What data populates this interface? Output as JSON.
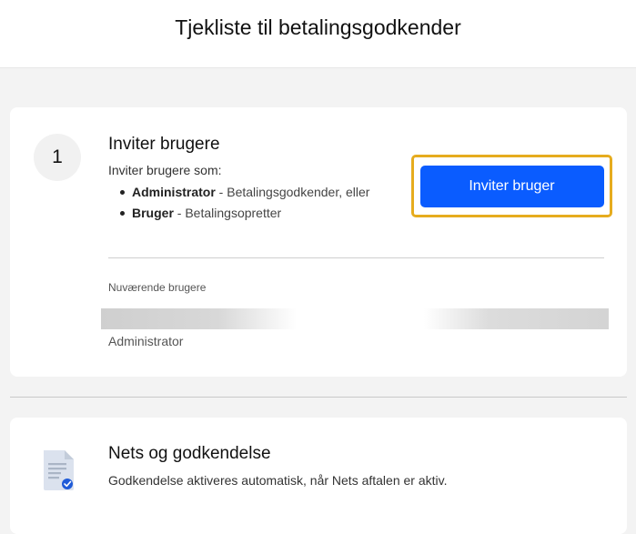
{
  "header": {
    "title": "Tjekliste til betalingsgodkender"
  },
  "step1": {
    "number": "1",
    "title": "Inviter brugere",
    "subtitle": "Inviter brugere som:",
    "roles": [
      {
        "name": "Administrator",
        "description": " - Betalingsgodkender, eller"
      },
      {
        "name": "Bruger",
        "description": " - Betalingsopretter"
      }
    ],
    "invite_button_label": "Inviter bruger",
    "current_users_label": "Nuværende brugere",
    "current_user_role": "Administrator",
    "accent_color": "#0a5cff",
    "highlight_color": "#e6ac1e"
  },
  "step2": {
    "icon": "document-check-icon",
    "title": "Nets og godkendelse",
    "text": "Godkendelse aktiveres automatisk, når Nets aftalen er aktiv."
  }
}
